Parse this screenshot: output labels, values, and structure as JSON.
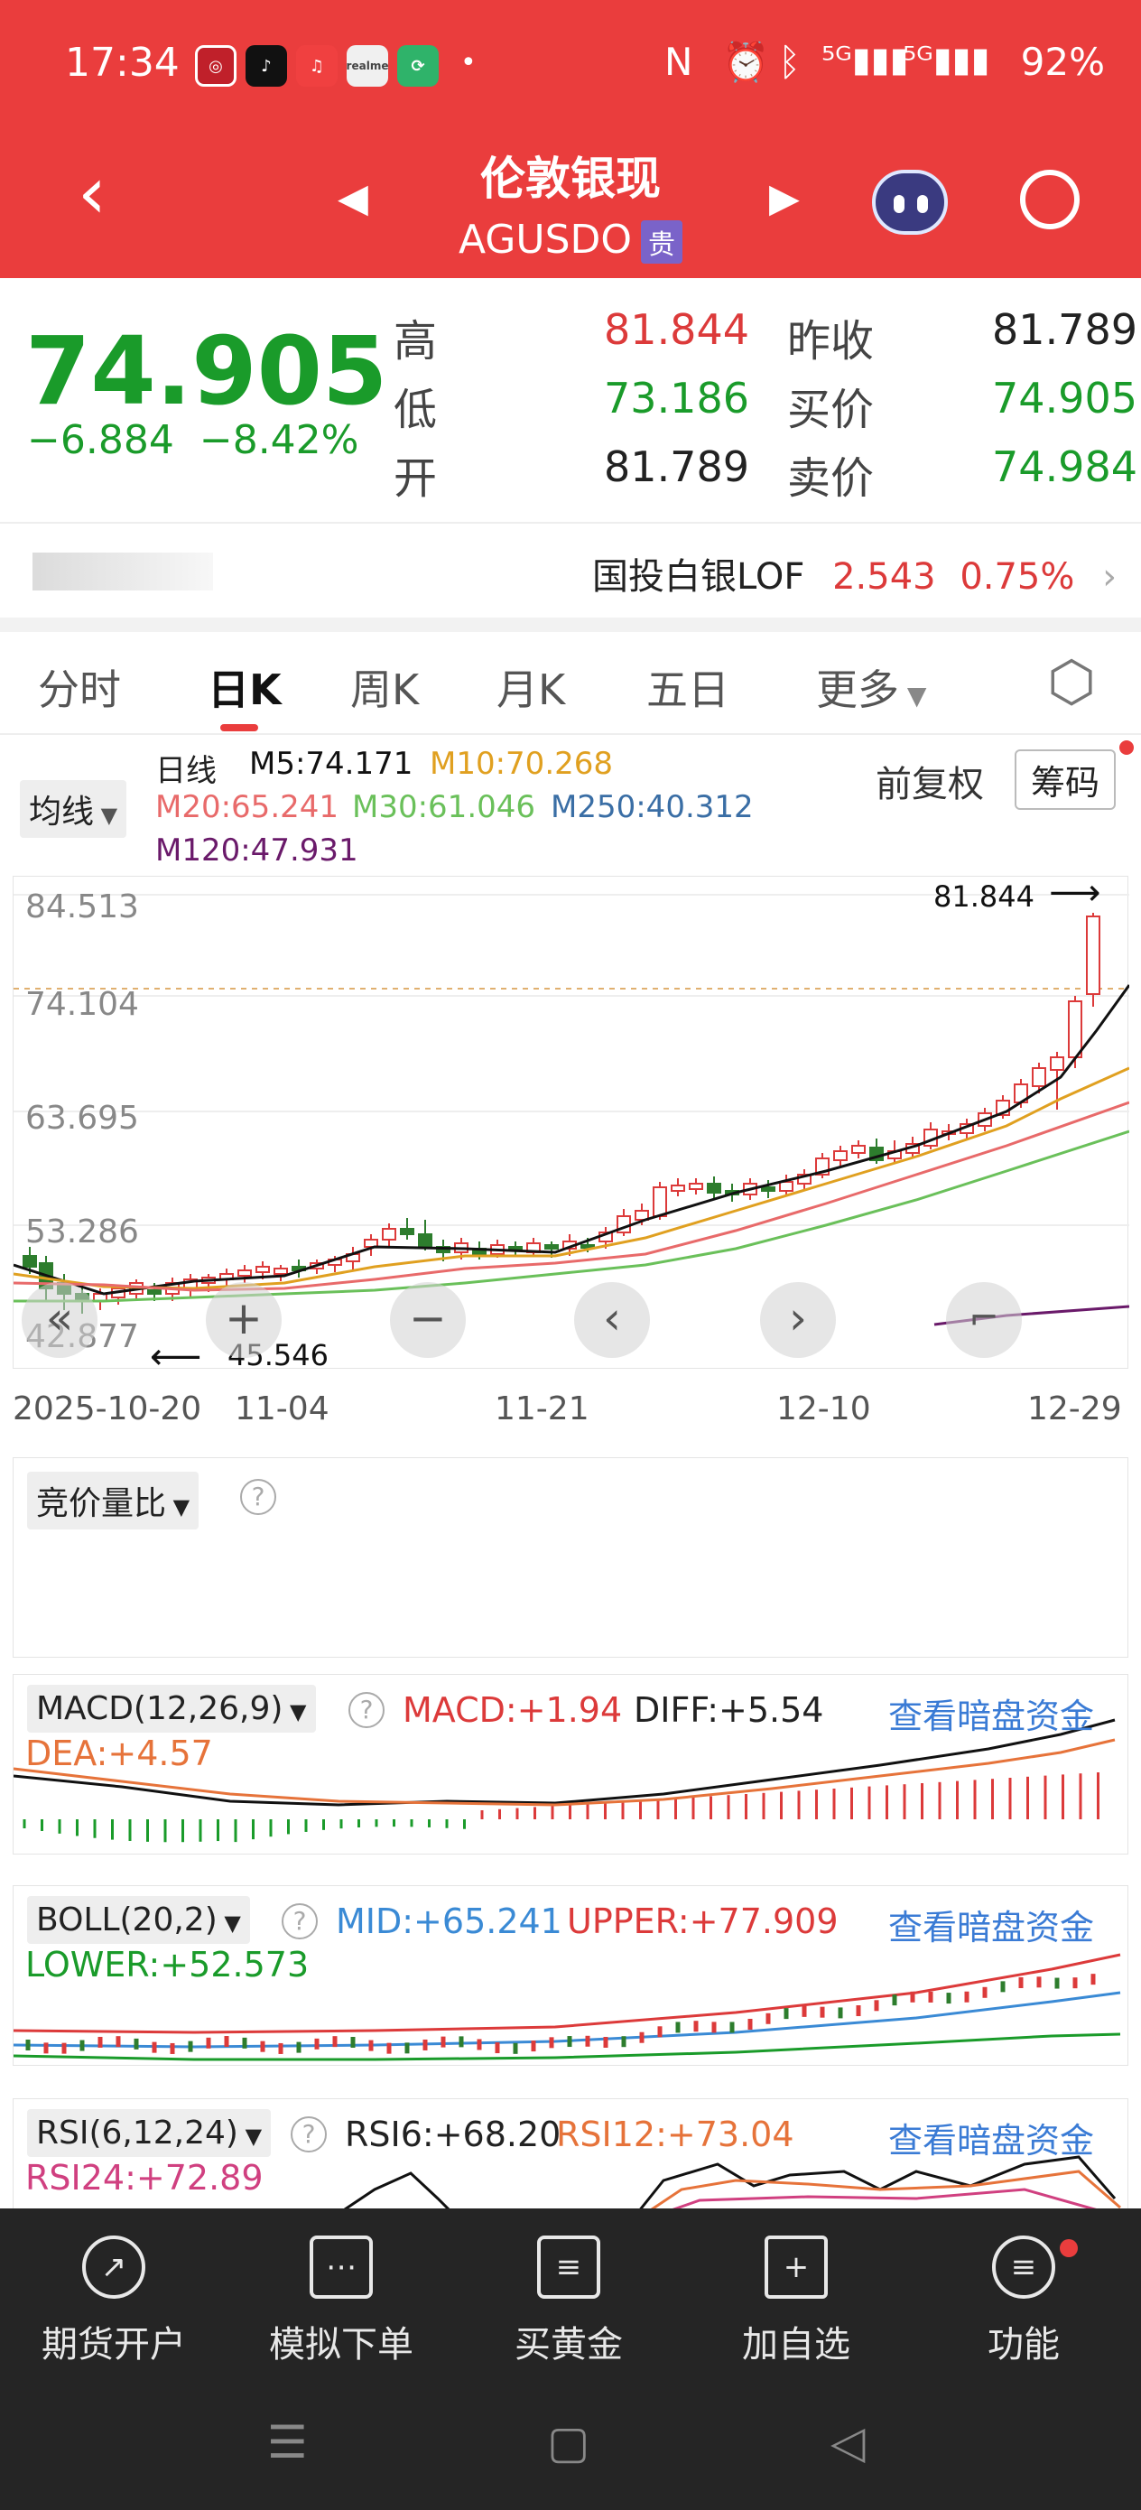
{
  "status_bar": {
    "time": "17:34",
    "battery": "92%",
    "icons": [
      "nfc-icon",
      "alarm-icon",
      "bluetooth-icon",
      "signal-5g-icon",
      "signal-5g-icon",
      "battery-icon"
    ]
  },
  "nav": {
    "title": "伦敦银现",
    "symbol": "AGUSDO",
    "tag": "贵"
  },
  "quote": {
    "price": "74.905",
    "change": "−6.884",
    "change_pct": "−8.42%",
    "rows": [
      {
        "label1": "高",
        "value1": "81.844",
        "label2": "昨收",
        "value2": "81.789"
      },
      {
        "label1": "低",
        "value1": "73.186",
        "label2": "买价",
        "value2": "74.905"
      },
      {
        "label1": "开",
        "value1": "81.789",
        "label2": "卖价",
        "value2": "74.984"
      }
    ]
  },
  "related": {
    "name": "国投白银LOF",
    "price": "2.543",
    "pct": "0.75%"
  },
  "tabs": [
    "分时",
    "日K",
    "周K",
    "月K",
    "五日",
    "更多"
  ],
  "ma": {
    "selector": "均线",
    "period": "日线",
    "m5": "M5:74.171",
    "m10": "M10:70.268",
    "m20": "M20:65.241",
    "m30": "M30:61.046",
    "m250": "M250:40.312",
    "m120": "M120:47.931",
    "adjust": "前复权",
    "chips": "筹码"
  },
  "kline": {
    "y_ticks": [
      "84.513",
      "74.104",
      "63.695",
      "53.286",
      "42.877"
    ],
    "x_ticks": [
      "2025-10-20",
      "11-04",
      "11-21",
      "12-10",
      "12-29"
    ],
    "high_label": "81.844",
    "low_label": "45.546"
  },
  "volume_panel": {
    "label": "竞价量比"
  },
  "macd": {
    "label": "MACD(12,26,9)",
    "macd": "MACD:+1.94",
    "diff": "DIFF:+5.54",
    "dea": "DEA:+4.57",
    "link": "查看暗盘资金"
  },
  "boll": {
    "label": "BOLL(20,2)",
    "mid": "MID:+65.241",
    "upper": "UPPER:+77.909",
    "lower": "LOWER:+52.573",
    "link": "查看暗盘资金"
  },
  "rsi": {
    "label": "RSI(6,12,24)",
    "rsi6": "RSI6:+68.20",
    "rsi12": "RSI12:+73.04",
    "rsi24": "RSI24:+72.89",
    "link": "查看暗盘资金"
  },
  "bottom_nav": [
    {
      "label": "期货开户",
      "icon": "compass-icon"
    },
    {
      "label": "模拟下单",
      "icon": "document-icon"
    },
    {
      "label": "买黄金",
      "icon": "list-icon"
    },
    {
      "label": "加自选",
      "icon": "plus-icon"
    },
    {
      "label": "功能",
      "icon": "menu-icon"
    }
  ],
  "colors": {
    "header": "#ea3d3d",
    "up": "#dc3a3a",
    "down": "#1a9b2a",
    "m5": "#111111",
    "m10": "#e0a020",
    "m20": "#e86a6a",
    "m30": "#6ac05a",
    "m250": "#3a6ea5",
    "m120": "#6a1a6a"
  }
}
